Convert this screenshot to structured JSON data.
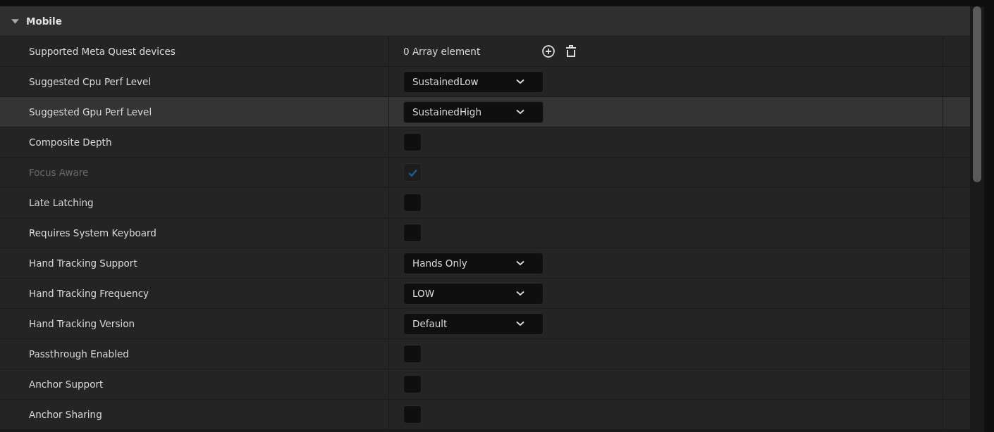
{
  "section": {
    "title": "Mobile",
    "expanded": true
  },
  "rows": [
    {
      "kind": "array",
      "label": "Supported Meta Quest devices",
      "value": "0 Array element",
      "selected": false,
      "disabled": false
    },
    {
      "kind": "dropdown",
      "label": "Suggested Cpu Perf Level",
      "value": "SustainedLow",
      "selected": false,
      "disabled": false
    },
    {
      "kind": "dropdown",
      "label": "Suggested Gpu Perf Level",
      "value": "SustainedHigh",
      "selected": true,
      "disabled": false
    },
    {
      "kind": "checkbox",
      "label": "Composite Depth",
      "checked": false,
      "selected": false,
      "disabled": false
    },
    {
      "kind": "checkbox",
      "label": "Focus Aware",
      "checked": true,
      "selected": false,
      "disabled": true
    },
    {
      "kind": "checkbox",
      "label": "Late Latching",
      "checked": false,
      "selected": false,
      "disabled": false
    },
    {
      "kind": "checkbox",
      "label": "Requires System Keyboard",
      "checked": false,
      "selected": false,
      "disabled": false
    },
    {
      "kind": "dropdown",
      "label": "Hand Tracking Support",
      "value": "Hands Only",
      "selected": false,
      "disabled": false
    },
    {
      "kind": "dropdown",
      "label": "Hand Tracking Frequency",
      "value": "LOW",
      "selected": false,
      "disabled": false
    },
    {
      "kind": "dropdown",
      "label": "Hand Tracking Version",
      "value": "Default",
      "selected": false,
      "disabled": false
    },
    {
      "kind": "checkbox",
      "label": "Passthrough Enabled",
      "checked": false,
      "selected": false,
      "disabled": false
    },
    {
      "kind": "checkbox",
      "label": "Anchor Support",
      "checked": false,
      "selected": false,
      "disabled": false
    },
    {
      "kind": "checkbox",
      "label": "Anchor Sharing",
      "checked": false,
      "selected": false,
      "disabled": false
    }
  ]
}
